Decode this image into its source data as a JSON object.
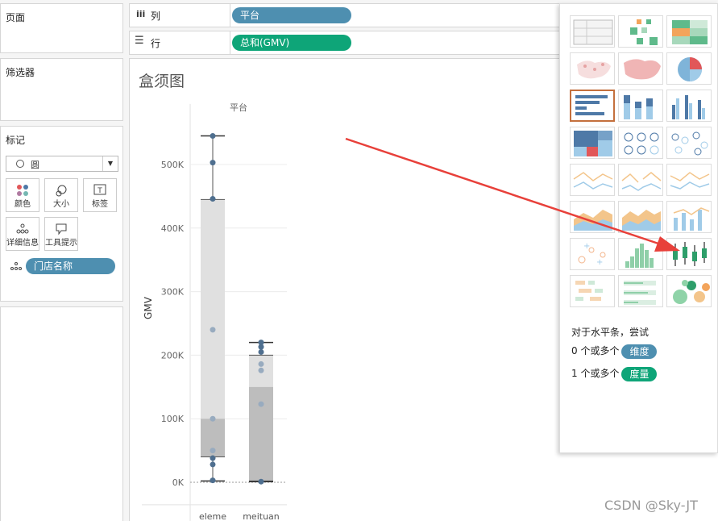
{
  "left_panel": {
    "pages_title": "页面",
    "filters_title": "筛选器",
    "marks_title": "标记",
    "mark_type": "圆",
    "mark_buttons": [
      {
        "label": "颜色",
        "icon": "color-dots-icon"
      },
      {
        "label": "大小",
        "icon": "size-icon"
      },
      {
        "label": "标签",
        "icon": "label-t-icon"
      },
      {
        "label": "详细信息",
        "icon": "detail-dots-icon"
      },
      {
        "label": "工具提示",
        "icon": "tooltip-icon"
      }
    ],
    "detail_field": "门店名称"
  },
  "shelves": {
    "columns_label": "列",
    "columns_pill": "平台",
    "rows_label": "行",
    "rows_pill": "总和(GMV)"
  },
  "worksheet_title": "盒须图",
  "show_me": {
    "hint_title": "对于水平条，尝试",
    "req_dim_prefix": "0 个或多个",
    "req_dim_badge": "维度",
    "req_mea_prefix": "1 个或多个",
    "req_mea_badge": "度量"
  },
  "watermark": "CSDN @Sky-JT",
  "colors": {
    "dimension": "#4e8fb0",
    "measure": "#0ea578",
    "arrow": "#e8403a",
    "point": "#4f6f8f"
  },
  "chart_data": {
    "type": "box",
    "title": "",
    "column_header": "平台",
    "xlabel": "",
    "ylabel": "GMV",
    "ylim": [
      -10000,
      570000
    ],
    "yticks": [
      0,
      100000,
      200000,
      300000,
      400000,
      500000
    ],
    "ytick_labels": [
      "0K",
      "100K",
      "200K",
      "300K",
      "400K",
      "500K"
    ],
    "categories": [
      "eleme",
      "meituan"
    ],
    "boxes": [
      {
        "name": "eleme",
        "min": 2000,
        "q1": 40000,
        "median": 100000,
        "q3": 445000,
        "max": 545000,
        "points": [
          545000,
          503000,
          446000,
          240000,
          100000,
          50000,
          38000,
          28000,
          3000
        ]
      },
      {
        "name": "meituan",
        "min": 1000,
        "q1": 2000,
        "median": 150000,
        "q3": 200000,
        "max": 220000,
        "points": [
          220000,
          213000,
          205000,
          186000,
          176000,
          123000,
          1000
        ]
      }
    ]
  }
}
